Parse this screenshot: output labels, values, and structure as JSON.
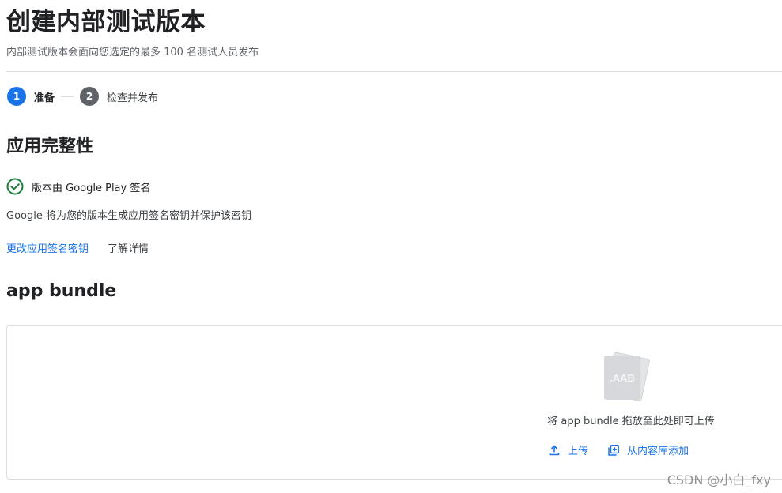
{
  "header": {
    "title": "创建内部测试版本",
    "subtitle": "内部测试版本会面向您选定的最多 100 名测试人员发布"
  },
  "stepper": {
    "steps": [
      {
        "number": "1",
        "label": "准备",
        "state": "active"
      },
      {
        "number": "2",
        "label": "检查并发布",
        "state": "inactive"
      }
    ]
  },
  "app_integrity": {
    "title": "应用完整性",
    "signing_status": "版本由 Google Play 签名",
    "signing_description": "Google 将为您的版本生成应用签名密钥并保护该密钥",
    "change_key_link": "更改应用签名密钥",
    "learn_more_link": "了解详情"
  },
  "app_bundle": {
    "title": "app bundle",
    "file_icon_label": ".AAB",
    "drop_hint": "将 app bundle 拖放至此处即可上传",
    "upload_label": "上传",
    "add_from_library_label": "从内容库添加"
  },
  "watermark": "CSDN @小白_fxy",
  "colors": {
    "accent": "#1a73e8",
    "success": "#188038",
    "inactive_step": "#5f6368"
  }
}
